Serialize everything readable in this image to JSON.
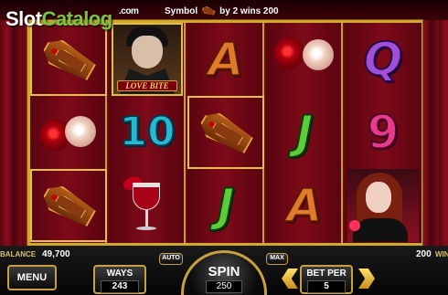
{
  "logo": {
    "slot": "Slot",
    "catalog": "Catalog",
    "com": ".com"
  },
  "message": {
    "prefix": "Symbol",
    "suffix": "by 2 wins 200",
    "symbol_icon": "coffin-icon"
  },
  "reels": [
    [
      "coffin",
      "roses",
      "coffin"
    ],
    [
      "vampire",
      "ten",
      "wine"
    ],
    [
      "A",
      "coffin",
      "J"
    ],
    [
      "roses",
      "J",
      "A"
    ],
    [
      "Q",
      "9",
      "lady"
    ]
  ],
  "symbols": {
    "vampire_banner": "LOVE BITE",
    "ten": "10",
    "a": "A",
    "j": "J",
    "q": "Q",
    "nine": "9"
  },
  "status": {
    "balance_label": "BALANCE",
    "balance": "49,700",
    "win": "200",
    "win_label": "WIN"
  },
  "controls": {
    "menu": "MENU",
    "ways_label": "WAYS",
    "ways_value": "243",
    "auto": "AUTO",
    "max": "MAX",
    "spin": "SPIN",
    "spin_value": "250",
    "betper_label": "BET PER",
    "betper_value": "5"
  },
  "colors": {
    "frame": "#d4a82a",
    "reel_bg": "#7d0a18",
    "catalog_green": "#7dc242"
  }
}
